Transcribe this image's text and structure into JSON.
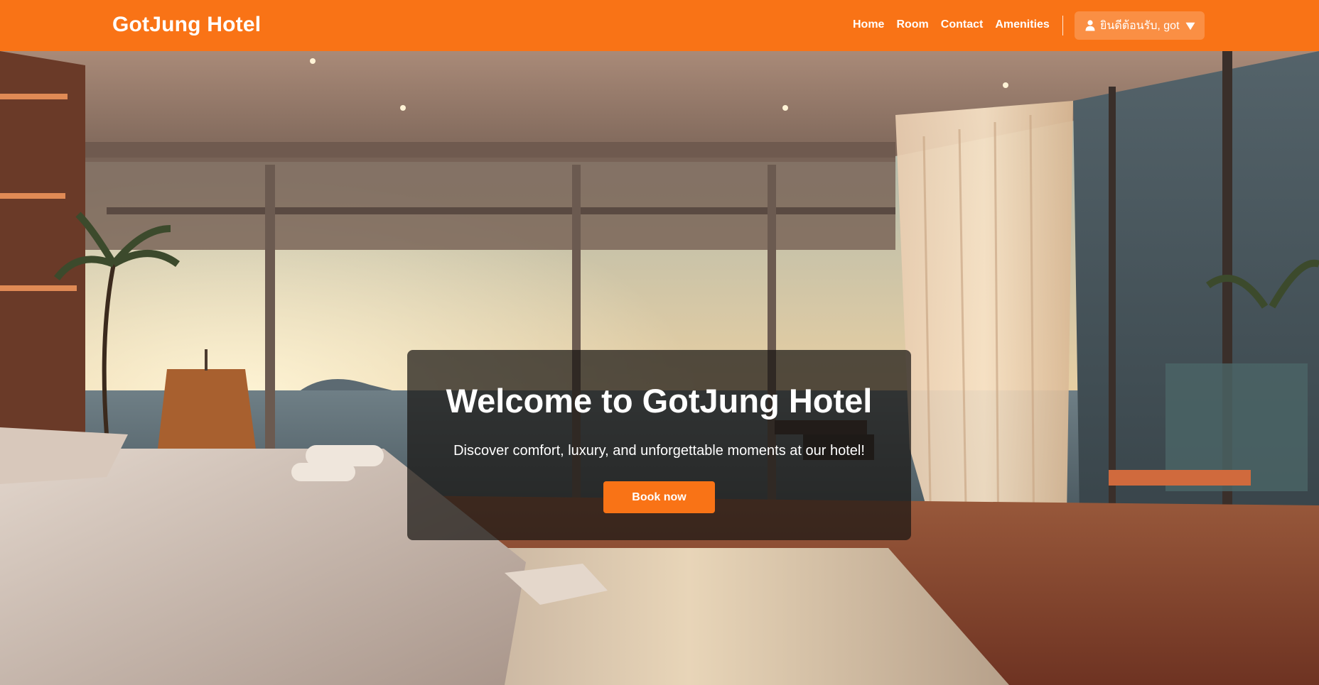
{
  "navbar": {
    "brand": "GotJung Hotel",
    "links": [
      "Home",
      "Room",
      "Contact",
      "Amenities"
    ],
    "user_menu": {
      "icon": "user-icon",
      "label": "ยินดีต้อนรับ, got",
      "caret_icon": "caret-down-icon"
    }
  },
  "hero": {
    "background": "hotel-room-ocean-view-image",
    "title": "Welcome to GotJung Hotel",
    "subtitle": "Discover comfort, luxury, and unforgettable moments at our hotel!",
    "cta_label": "Book now"
  },
  "colors": {
    "accent": "#f97316",
    "overlay": "rgba(25,22,20,0.72)",
    "text": "#ffffff"
  }
}
